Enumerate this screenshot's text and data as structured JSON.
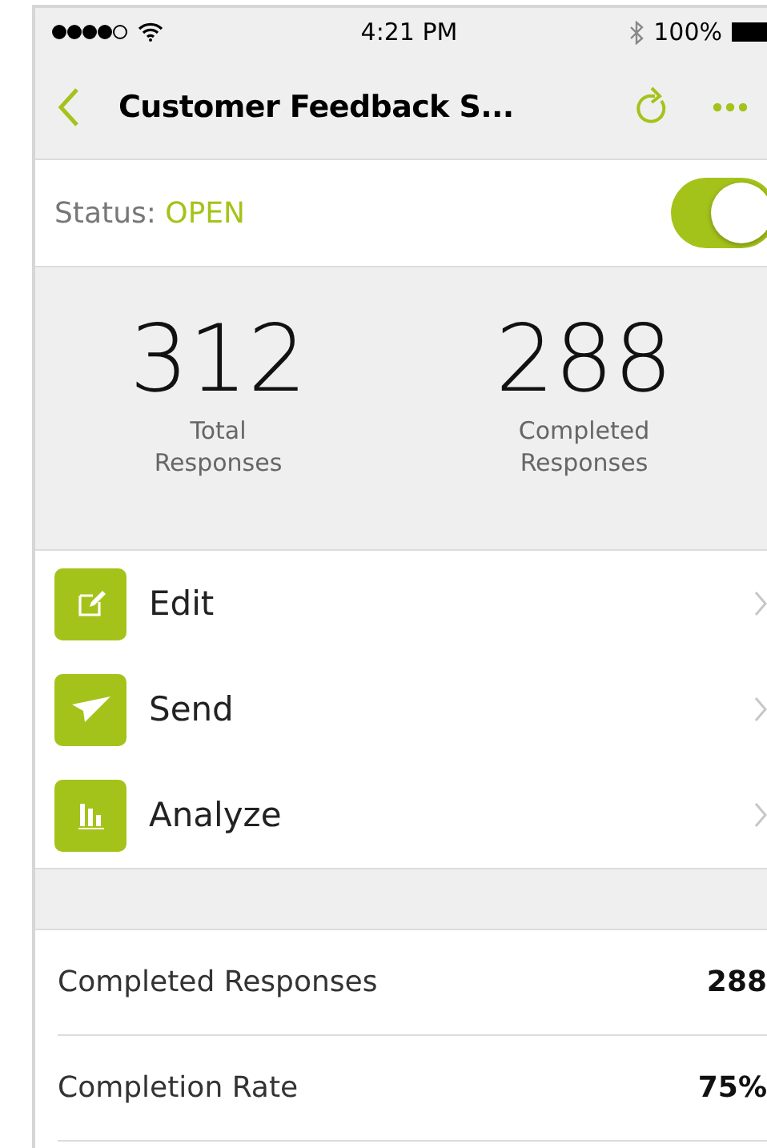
{
  "status_bar": {
    "time": "4:21 PM",
    "battery": "100%"
  },
  "nav_bar": {
    "title": "Customer Feedback S..."
  },
  "status_row": {
    "label": "Status:",
    "value": "OPEN",
    "on": true
  },
  "stats": [
    {
      "value": "312",
      "label": "Total Responses"
    },
    {
      "value": "288",
      "label": "Completed Responses"
    }
  ],
  "menu": [
    {
      "kind": "edit",
      "label": "Edit"
    },
    {
      "kind": "send",
      "label": "Send"
    },
    {
      "kind": "analyze",
      "label": "Analyze"
    }
  ],
  "details": [
    {
      "label": "Completed Responses",
      "value": "288"
    },
    {
      "label": "Completion Rate",
      "value": "75%"
    }
  ]
}
